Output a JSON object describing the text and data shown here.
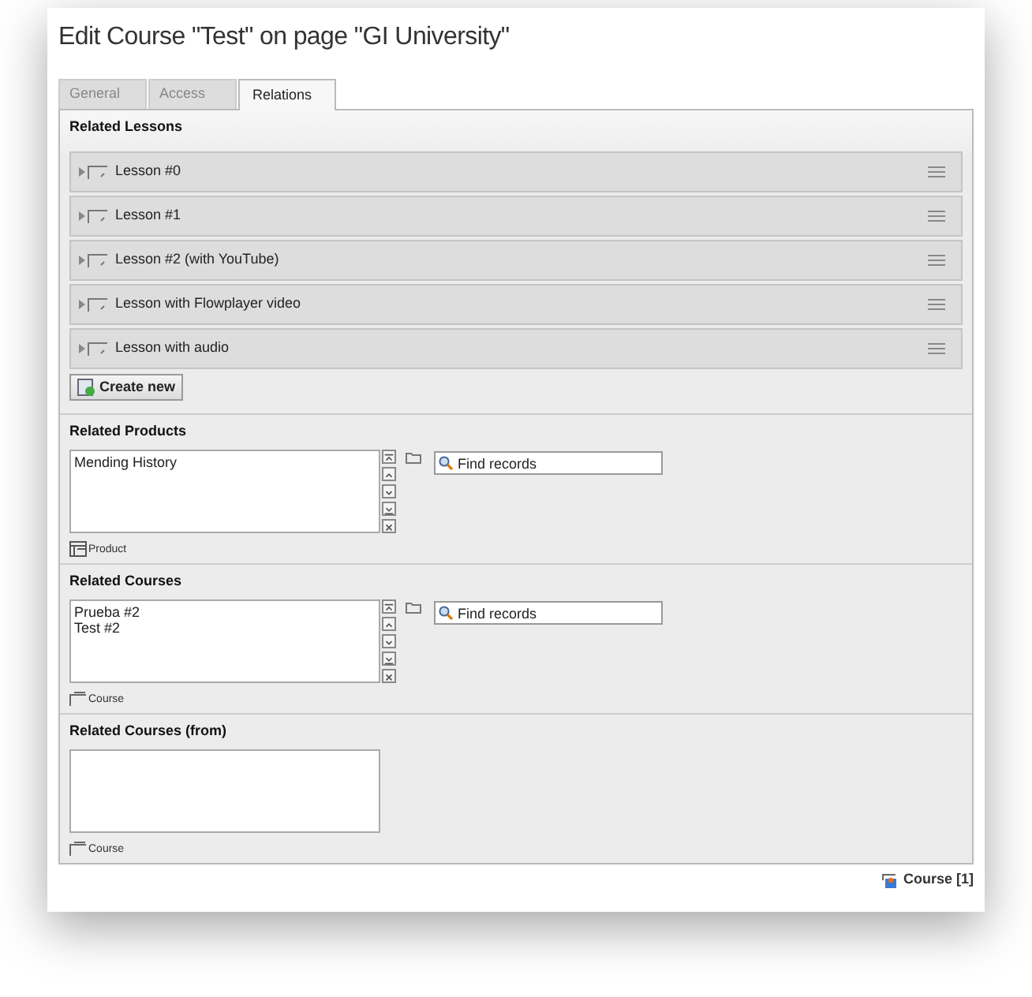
{
  "window": {
    "title": "Edit Course \"Test\" on page \"GI University\""
  },
  "tabs": [
    {
      "label": "General",
      "selected": false
    },
    {
      "label": "Access",
      "selected": false
    },
    {
      "label": "Relations",
      "selected": true
    }
  ],
  "lessons": {
    "heading": "Related Lessons",
    "items": [
      {
        "label": "Lesson #0",
        "expanded": false
      },
      {
        "label": "Lesson #1",
        "expanded": false
      },
      {
        "label": "Lesson #2 (with YouTube)",
        "expanded": false
      },
      {
        "label": "Lesson with Flowplayer video",
        "expanded": false
      },
      {
        "label": "Lesson with audio",
        "expanded": false
      }
    ],
    "create_button": "Create new"
  },
  "relations": [
    {
      "kind": "select",
      "heading": "Related Products",
      "entries": [
        "Mending History"
      ],
      "search": {
        "placeholder": "Find records"
      },
      "table": {
        "kind": "product",
        "label": "Product"
      }
    },
    {
      "kind": "select",
      "heading": "Related Courses",
      "entries": [
        "Prueba #2",
        "Test #2"
      ],
      "search": {
        "placeholder": "Find records"
      },
      "table": {
        "kind": "course",
        "label": "Course"
      }
    },
    {
      "kind": "readonly",
      "heading": "Related Courses (from)",
      "table": {
        "kind": "course",
        "label": "Course"
      }
    }
  ],
  "footer": {
    "record": "Course [1]"
  }
}
